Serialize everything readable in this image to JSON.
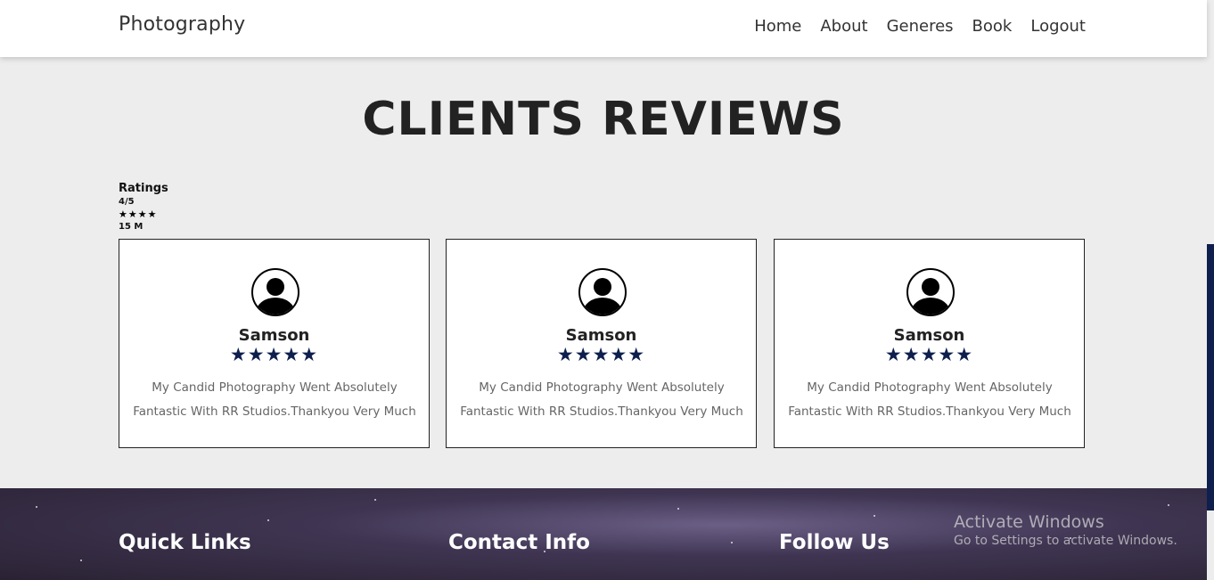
{
  "navbar": {
    "brand": "Photography",
    "links": [
      "Home",
      "About",
      "Generes",
      "Book",
      "Logout"
    ]
  },
  "section": {
    "title": "CLIENTS REVIEWS"
  },
  "ratings": {
    "label": "Ratings",
    "score": "4/5",
    "stars": "★★★★",
    "count": "15 M"
  },
  "reviews": [
    {
      "name": "Samson",
      "stars": "★★★★★",
      "line1": "My Candid Photography Went Absolutely",
      "line2": "Fantastic With RR Studios.Thankyou Very Much"
    },
    {
      "name": "Samson",
      "stars": "★★★★★",
      "line1": "My Candid Photography Went Absolutely",
      "line2": "Fantastic With RR Studios.Thankyou Very Much"
    },
    {
      "name": "Samson",
      "stars": "★★★★★",
      "line1": "My Candid Photography Went Absolutely",
      "line2": "Fantastic With RR Studios.Thankyou Very Much"
    }
  ],
  "footer": {
    "headings": [
      "Quick Links",
      "Contact Info",
      "Follow Us"
    ]
  },
  "watermark": {
    "title": "Activate Windows",
    "subtitle": "Go to Settings to activate Windows."
  },
  "colors": {
    "accent": "#0e1f4d",
    "background": "#ededed"
  },
  "icons": [
    "user-avatar-icon",
    "star-icon"
  ]
}
